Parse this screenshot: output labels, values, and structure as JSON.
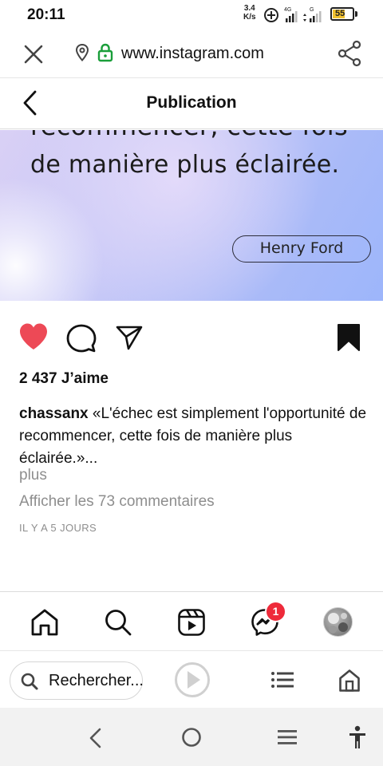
{
  "status_bar": {
    "time": "20:11",
    "speed_value": "3.4",
    "speed_unit": "K/s",
    "network_1": "4G",
    "network_2": "G",
    "battery": "55"
  },
  "browser": {
    "url": "www.instagram.com",
    "search_label": "Rechercher..."
  },
  "header": {
    "title": "Publication"
  },
  "post": {
    "quote_line1": "recommencer, cette fois",
    "quote_line2": "de manière plus éclairée.",
    "author": "Henry Ford",
    "likes": "2 437 J’aime",
    "username": "chassanx",
    "caption": "«L'échec est simplement l'opportunité de recommencer, cette fois de manière plus éclairée.»...",
    "more_label": "plus",
    "view_comments": "Afficher les 73 commentaires",
    "time_ago": "IL Y A 5 JOURS",
    "liked": true,
    "saved": true
  },
  "ig_nav": {
    "messenger_badge": "1"
  },
  "colors": {
    "like_red": "#ed4956",
    "badge_red": "#ee2a3a",
    "lock_green": "#1a9e3a",
    "muted_text": "#8e8e8e"
  },
  "icons": [
    "close-icon",
    "location-icon",
    "lock-icon",
    "share-icon",
    "back-arrow-icon",
    "heart-icon",
    "comment-icon",
    "send-icon",
    "bookmark-icon",
    "home-icon",
    "search-icon",
    "reels-icon",
    "messenger-icon",
    "avatar",
    "play-icon",
    "list-icon",
    "browser-home-icon",
    "nav-back-icon",
    "nav-home-icon",
    "nav-recents-icon",
    "accessibility-icon"
  ]
}
